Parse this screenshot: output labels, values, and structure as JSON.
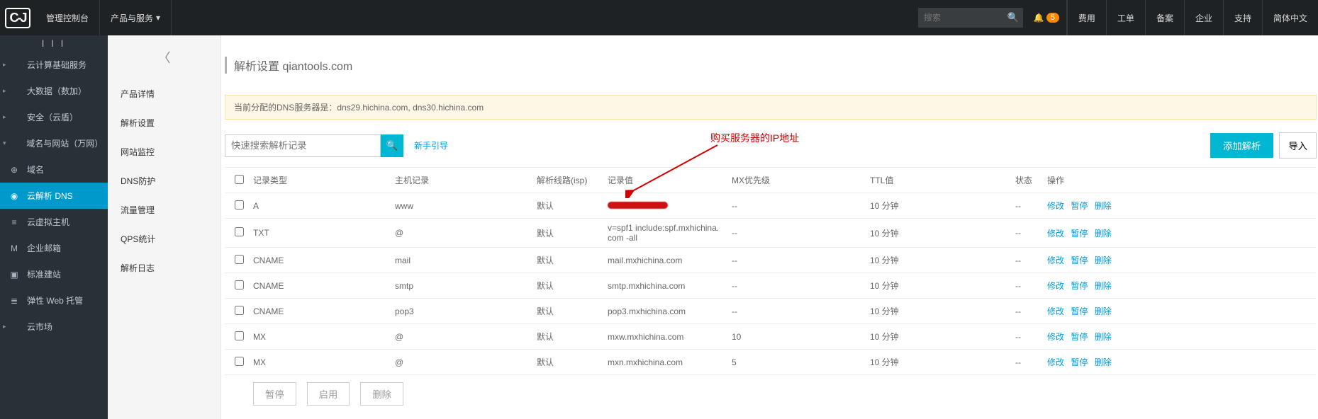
{
  "topbar": {
    "console_label": "管理控制台",
    "products_label": "产品与服务",
    "search_placeholder": "搜索",
    "badge_count": "5",
    "links": {
      "fee": "费用",
      "ticket": "工单",
      "filing": "备案",
      "enterprise": "企业",
      "support": "支持",
      "lang": "简体中文"
    }
  },
  "sidebar": {
    "items": [
      {
        "label": "云计算基础服务",
        "caret": "▸",
        "icon": ""
      },
      {
        "label": "大数据（数加）",
        "caret": "▸",
        "icon": ""
      },
      {
        "label": "安全（云盾）",
        "caret": "▸",
        "icon": ""
      },
      {
        "label": "域名与网站（万网）",
        "caret": "▾",
        "icon": ""
      },
      {
        "label": "域名",
        "caret": "",
        "icon": "⊕"
      },
      {
        "label": "云解析 DNS",
        "caret": "",
        "icon": "◉",
        "active": true
      },
      {
        "label": "云虚拟主机",
        "caret": "",
        "icon": "≡"
      },
      {
        "label": "企业邮箱",
        "caret": "",
        "icon": "M"
      },
      {
        "label": "标准建站",
        "caret": "",
        "icon": "▣"
      },
      {
        "label": "弹性 Web 托管",
        "caret": "",
        "icon": "≣"
      },
      {
        "label": "云市场",
        "caret": "▸",
        "icon": ""
      }
    ]
  },
  "subnav": {
    "items": [
      "产品详情",
      "解析设置",
      "网站监控",
      "DNS防护",
      "流量管理",
      "QPS统计",
      "解析日志"
    ]
  },
  "main": {
    "crumb_prefix": "解析设置 ",
    "crumb_domain": "qiantools.com",
    "alert_text": "当前分配的DNS服务器是：dns29.hichina.com, dns30.hichina.com",
    "search_placeholder": "快速搜索解析记录",
    "guide_label": "新手引导",
    "add_label": "添加解析",
    "import_label": "导入",
    "annotation": "购买服务器的IP地址",
    "table": {
      "headers": [
        "记录类型",
        "主机记录",
        "解析线路(isp)",
        "记录值",
        "MX优先级",
        "TTL值",
        "状态",
        "操作"
      ],
      "ops": [
        "修改",
        "暂停",
        "删除"
      ],
      "rows": [
        {
          "type": "A",
          "host": "www",
          "isp": "默认",
          "val": "hidden",
          "prio": "--",
          "ttl": "10 分钟",
          "status": "--"
        },
        {
          "type": "TXT",
          "host": "@",
          "isp": "默认",
          "val": "v=spf1 include:spf.mxhichina.com -all",
          "prio": "--",
          "ttl": "10 分钟",
          "status": "--"
        },
        {
          "type": "CNAME",
          "host": "mail",
          "isp": "默认",
          "val": "mail.mxhichina.com",
          "prio": "--",
          "ttl": "10 分钟",
          "status": "--"
        },
        {
          "type": "CNAME",
          "host": "smtp",
          "isp": "默认",
          "val": "smtp.mxhichina.com",
          "prio": "--",
          "ttl": "10 分钟",
          "status": "--"
        },
        {
          "type": "CNAME",
          "host": "pop3",
          "isp": "默认",
          "val": "pop3.mxhichina.com",
          "prio": "--",
          "ttl": "10 分钟",
          "status": "--"
        },
        {
          "type": "MX",
          "host": "@",
          "isp": "默认",
          "val": "mxw.mxhichina.com",
          "prio": "10",
          "ttl": "10 分钟",
          "status": "--"
        },
        {
          "type": "MX",
          "host": "@",
          "isp": "默认",
          "val": "mxn.mxhichina.com",
          "prio": "5",
          "ttl": "10 分钟",
          "status": "--"
        }
      ],
      "footer_btns": [
        "暂停",
        "启用",
        "删除"
      ]
    }
  }
}
